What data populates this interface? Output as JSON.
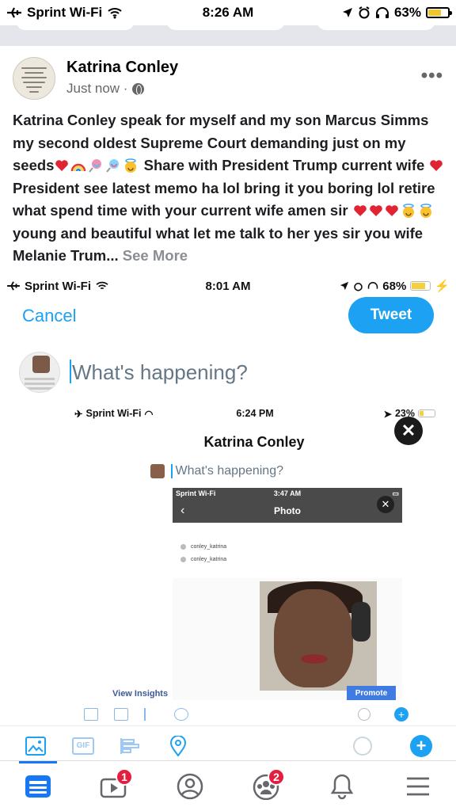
{
  "status_bar": {
    "carrier": "Sprint Wi-Fi",
    "time": "8:26 AM",
    "battery": "63%",
    "battery_level": 0.63
  },
  "post": {
    "author": "Katrina Conley",
    "timestamp": "Just now ·",
    "text_name": "Katrina Conley",
    "text_1": " speak for myself and my son Marcus Simms my second oldest Supreme Court demanding just on my seeds",
    "text_2": " Share with President Trump current wife ",
    "text_3": " President see latest memo ha lol bring it you boring lol retire what spend time with your current wife amen sir ",
    "text_4": "young and beautiful what let me talk to her yes sir you wife Melanie Trum...",
    "see_more": " See More"
  },
  "tweet_screen": {
    "status": {
      "carrier": "Sprint Wi-Fi",
      "time": "8:01 AM",
      "battery": "68%",
      "battery_level": 0.68
    },
    "cancel_label": "Cancel",
    "tweet_label": "Tweet",
    "compose_placeholder": "What's happening?",
    "nested": {
      "status": {
        "carrier": "Sprint Wi-Fi",
        "time": "6:24 PM",
        "battery": "23%",
        "battery_level": 0.23
      },
      "title": "Katrina Conley",
      "compose_placeholder": "What's happening?",
      "deep": {
        "status": {
          "carrier": "Sprint Wi-Fi",
          "time": "3:47 AM"
        },
        "title": "Photo",
        "rows": [
          "conley_katrina",
          "conley_katrina"
        ],
        "view_insights": "View Insights",
        "promote": "Promote"
      }
    },
    "toolbar": {
      "gif_label": "GIF"
    }
  },
  "tabbar": {
    "watch_badge": "1",
    "groups_badge": "2"
  },
  "colors": {
    "facebook_blue": "#1877f2",
    "twitter_blue": "#1da1f2",
    "badge_red": "#e41e3f"
  }
}
